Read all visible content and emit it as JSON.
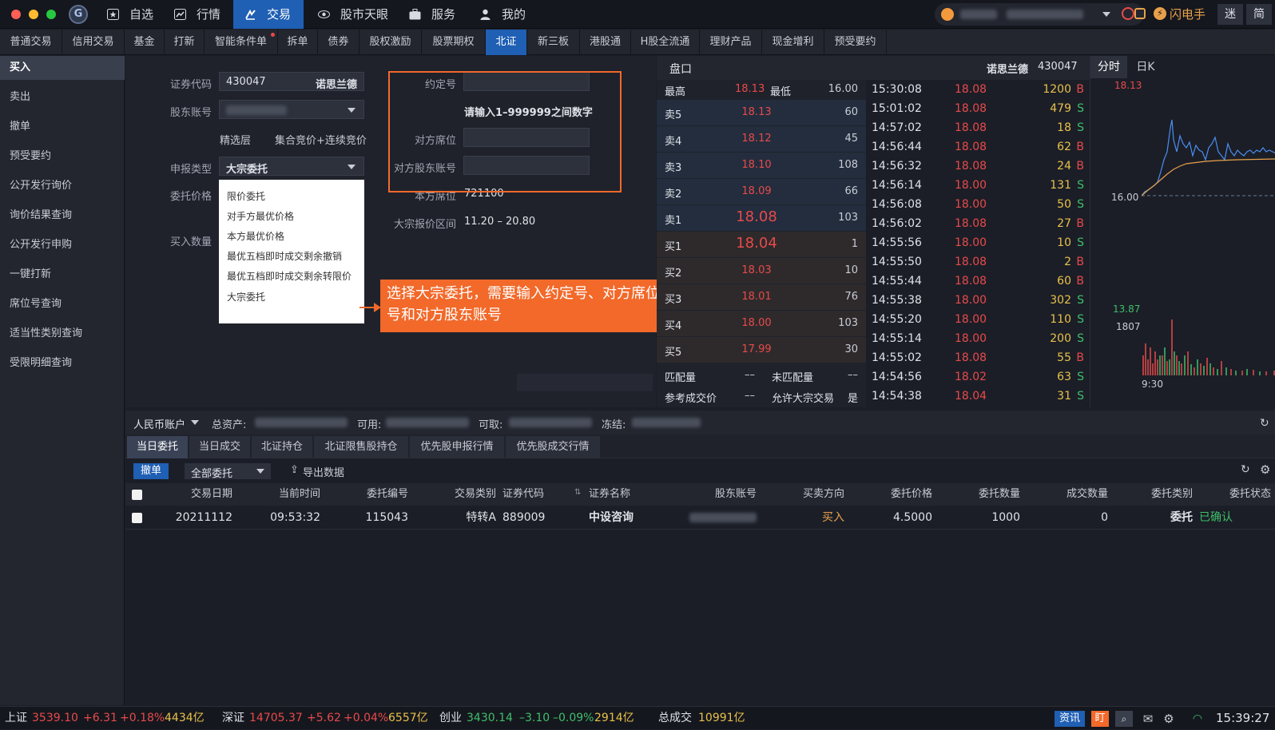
{
  "colors": {
    "accent": "#1f5fb4",
    "up": "#e84a4a",
    "down": "#3fbf6a",
    "callout": "#f2692a",
    "volume": "#e8c14a"
  },
  "topnav": [
    {
      "label": "自选",
      "icon": "star-icon"
    },
    {
      "label": "行情",
      "icon": "chart-icon"
    },
    {
      "label": "交易",
      "icon": "trade-icon",
      "active": true
    },
    {
      "label": "股市天眼",
      "icon": "eye-icon"
    },
    {
      "label": "服务",
      "icon": "briefcase-icon"
    },
    {
      "label": "我的",
      "icon": "user-icon"
    }
  ],
  "titlebar_right": {
    "flash_label": "闪电手",
    "mini_label": "迷",
    "simple_label": "简"
  },
  "tabs": [
    "普通交易",
    "信用交易",
    "基金",
    "打新",
    "智能条件单",
    "拆单",
    "债券",
    "股权激励",
    "股票期权",
    "北证",
    "新三板",
    "港股通",
    "H股全流通",
    "理财产品",
    "现金增利",
    "预受要约"
  ],
  "sidebar": [
    "买入",
    "卖出",
    "撤单",
    "预受要约",
    "公开发行询价",
    "询价结果查询",
    "公开发行申购",
    "一键打新",
    "席位号查询",
    "适当性类别查询",
    "受限明细查询"
  ],
  "form": {
    "code_label": "证券代码",
    "code_value": "430047",
    "code_name": "诺思兰德",
    "holder_label": "股东账号",
    "tier": "精选层",
    "match_mode": "集合竞价+连续竞价",
    "report_type_label": "申报类型",
    "report_type_value": "大宗委托",
    "price_label": "委托价格",
    "qty_label": "买入数量",
    "agree_label": "约定号",
    "agree_hint": "请输入1–999999之间数字",
    "counter_seat_label": "对方席位",
    "counter_holder_label": "对方股东账号",
    "own_seat_label": "本方席位",
    "own_seat_value": "721100",
    "block_range_label": "大宗报价区间",
    "block_range_value": "11.20 – 20.80"
  },
  "dropdown_options": [
    "限价委托",
    "对手方最优价格",
    "本方最优价格",
    "最优五档即时成交剩余撤销",
    "最优五档即时成交剩余转限价",
    "大宗委托"
  ],
  "callout": "选择大宗委托，需要输入约定号、对方席位号和对方股东账号",
  "quote": {
    "title": "盘口",
    "name": "诺思兰德",
    "code": "430047",
    "high_label": "最高",
    "high": "18.13",
    "low_label": "最低",
    "low": "16.00",
    "sell": [
      {
        "label": "卖5",
        "price": "18.13",
        "vol": "60"
      },
      {
        "label": "卖4",
        "price": "18.12",
        "vol": "45"
      },
      {
        "label": "卖3",
        "price": "18.10",
        "vol": "108"
      },
      {
        "label": "卖2",
        "price": "18.09",
        "vol": "66"
      },
      {
        "label": "卖1",
        "price": "18.08",
        "vol": "103"
      }
    ],
    "buy": [
      {
        "label": "买1",
        "price": "18.04",
        "vol": "1"
      },
      {
        "label": "买2",
        "price": "18.03",
        "vol": "10"
      },
      {
        "label": "买3",
        "price": "18.01",
        "vol": "76"
      },
      {
        "label": "买4",
        "price": "18.00",
        "vol": "103"
      },
      {
        "label": "买5",
        "price": "17.99",
        "vol": "30"
      }
    ],
    "matched_label": "匹配量",
    "matched": "––",
    "unmatched_label": "未匹配量",
    "unmatched": "––",
    "ref_label": "参考成交价",
    "ref": "––",
    "allow_label": "允许大宗交易",
    "allow": "是"
  },
  "ticks": [
    {
      "t": "15:30:08",
      "p": "18.08",
      "v": "1200",
      "d": "B"
    },
    {
      "t": "15:01:02",
      "p": "18.08",
      "v": "479",
      "d": "S"
    },
    {
      "t": "14:57:02",
      "p": "18.08",
      "v": "18",
      "d": "S"
    },
    {
      "t": "14:56:44",
      "p": "18.08",
      "v": "62",
      "d": "B"
    },
    {
      "t": "14:56:32",
      "p": "18.08",
      "v": "24",
      "d": "B"
    },
    {
      "t": "14:56:14",
      "p": "18.00",
      "v": "131",
      "d": "S"
    },
    {
      "t": "14:56:08",
      "p": "18.00",
      "v": "50",
      "d": "S"
    },
    {
      "t": "14:56:02",
      "p": "18.08",
      "v": "27",
      "d": "B"
    },
    {
      "t": "14:55:56",
      "p": "18.00",
      "v": "10",
      "d": "S"
    },
    {
      "t": "14:55:50",
      "p": "18.08",
      "v": "2",
      "d": "B"
    },
    {
      "t": "14:55:44",
      "p": "18.08",
      "v": "60",
      "d": "B"
    },
    {
      "t": "14:55:38",
      "p": "18.00",
      "v": "302",
      "d": "S"
    },
    {
      "t": "14:55:20",
      "p": "18.00",
      "v": "110",
      "d": "S"
    },
    {
      "t": "14:55:14",
      "p": "18.00",
      "v": "200",
      "d": "S"
    },
    {
      "t": "14:55:02",
      "p": "18.08",
      "v": "55",
      "d": "B"
    },
    {
      "t": "14:54:56",
      "p": "18.02",
      "v": "63",
      "d": "S"
    },
    {
      "t": "14:54:38",
      "p": "18.04",
      "v": "31",
      "d": "S"
    }
  ],
  "chart": {
    "tab_intraday": "分时",
    "tab_daily": "日K",
    "top": "18.13",
    "mid": "16.00",
    "bottom": "13.87",
    "vol_max": "1807",
    "time_start": "9:30"
  },
  "account": {
    "type": "人民币账户",
    "total_label": "总资产:",
    "avail_label": "可用:",
    "withdraw_label": "可取:",
    "frozen_label": "冻结:"
  },
  "subtabs": [
    "当日委托",
    "当日成交",
    "北证持仓",
    "北证限售股持仓",
    "优先股申报行情",
    "优先股成交行情"
  ],
  "toolbar": {
    "cancel": "撤单",
    "filter": "全部委托",
    "export": "导出数据"
  },
  "table": {
    "headers": [
      "交易日期",
      "当前时间",
      "委托编号",
      "交易类别",
      "证券代码",
      "证券名称",
      "股东账号",
      "买卖方向",
      "委托价格",
      "委托数量",
      "成交数量",
      "委托类别",
      "委托状态"
    ],
    "rows": [
      {
        "date": "20211112",
        "time": "09:53:32",
        "no": "115043",
        "cat": "特转A",
        "code": "889009",
        "name": "中设咨询",
        "dir": "买入",
        "price": "4.5000",
        "qty": "1000",
        "deal": "0",
        "type": "委托",
        "status": "已确认"
      }
    ]
  },
  "status": {
    "sh_label": "上证",
    "sh_val": "3539.10",
    "sh_chg": "+6.31",
    "sh_pct": "+0.18%",
    "sh_amt": "4434亿",
    "sz_label": "深证",
    "sz_val": "14705.37",
    "sz_chg": "+5.62",
    "sz_pct": "+0.04%",
    "sz_amt": "6557亿",
    "cy_label": "创业",
    "cy_val": "3430.14",
    "cy_chg": "–3.10",
    "cy_pct": "–0.09%",
    "cy_amt": "2914亿",
    "total_label": "总成交",
    "total_amt": "10991亿",
    "news": "资讯",
    "ding": "盯",
    "time": "15:39:27"
  }
}
